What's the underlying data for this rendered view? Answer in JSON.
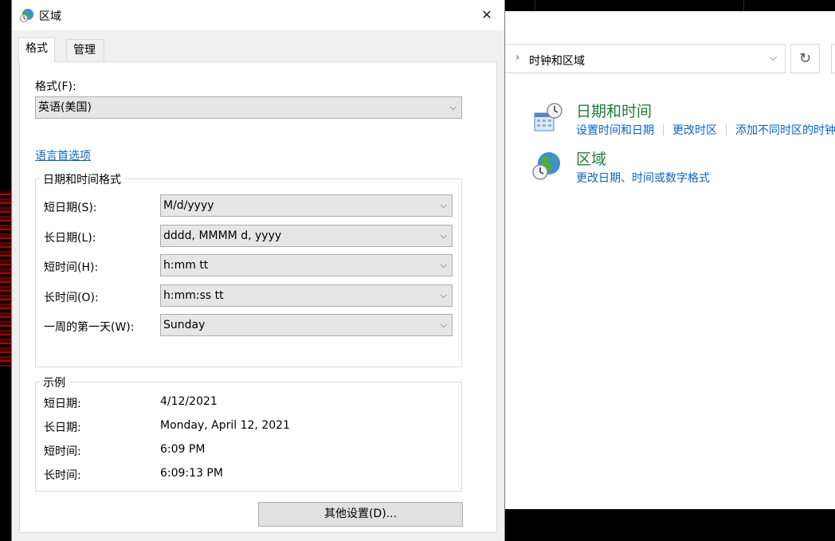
{
  "control_panel": {
    "breadcrumb": "时钟和区域",
    "categories": [
      {
        "title": "日期和时间",
        "links": [
          "设置时间和日期",
          "更改时区",
          "添加不同时区的时钟"
        ]
      },
      {
        "title": "区域",
        "links": [
          "更改日期、时间或数字格式"
        ]
      }
    ]
  },
  "dialog": {
    "title": "区域",
    "tabs": [
      "格式",
      "管理"
    ],
    "format_label": "格式(F):",
    "format_value": "英语(美国)",
    "language_link": "语言首选项",
    "datetime_group": {
      "title": "日期和时间格式",
      "rows": [
        {
          "label": "短日期(S):",
          "value": "M/d/yyyy"
        },
        {
          "label": "长日期(L):",
          "value": "dddd, MMMM d, yyyy"
        },
        {
          "label": "短时间(H):",
          "value": "h:mm tt"
        },
        {
          "label": "长时间(O):",
          "value": "h:mm:ss tt"
        },
        {
          "label": "一周的第一天(W):",
          "value": "Sunday"
        }
      ]
    },
    "example_group": {
      "title": "示例",
      "rows": [
        {
          "label": "短日期:",
          "value": "4/12/2021"
        },
        {
          "label": "长日期:",
          "value": "Monday, April 12, 2021"
        },
        {
          "label": "短时间:",
          "value": "6:09 PM"
        },
        {
          "label": "长时间:",
          "value": "6:09:13 PM"
        }
      ]
    },
    "additional_settings_button": "其他设置(D)..."
  }
}
